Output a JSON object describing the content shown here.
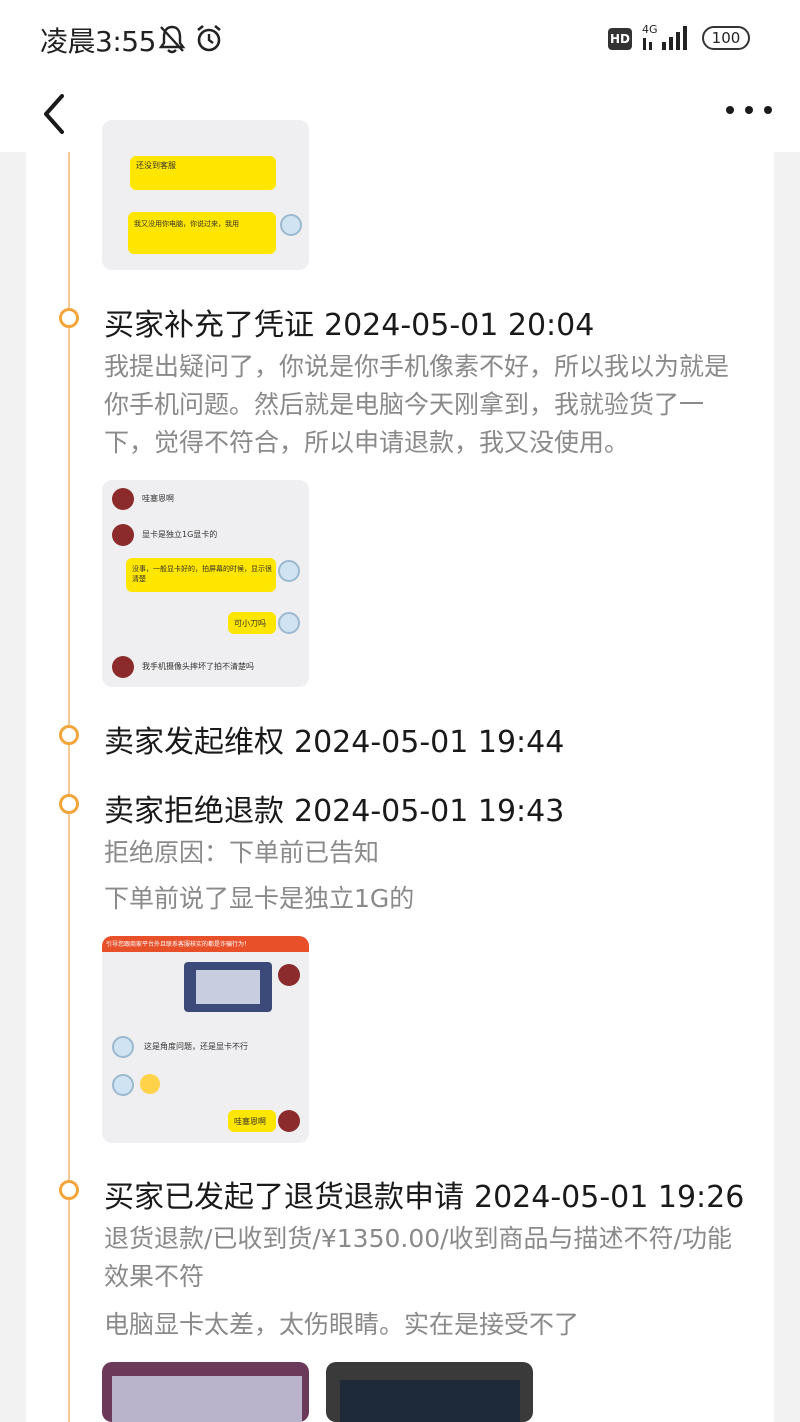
{
  "status_bar": {
    "time": "凌晨3:55",
    "network": "4G",
    "hd": "HD",
    "battery": "100"
  },
  "nav": {
    "back_icon": "back-arrow-icon",
    "more_icon": "more-dots-icon"
  },
  "colors": {
    "accent": "#f2a53a",
    "timeline": "#f3c895",
    "muted_text": "#8a8a8a",
    "chat_yellow": "#ffe600"
  },
  "events": [
    {
      "title": "买家补充了凭证",
      "time": "2024-05-01 20:04",
      "desc": "我提出疑问了，你说是你手机像素不好，所以我以为就是你手机问题。然后就是电脑今天刚拿到，我就验货了一下，觉得不符合，所以申请退款，我又没使用。"
    },
    {
      "title": "卖家发起维权",
      "time": "2024-05-01 19:44"
    },
    {
      "title": "卖家拒绝退款",
      "time": "2024-05-01 19:43",
      "reason": "拒绝原因：下单前已告知",
      "desc": "下单前说了显卡是独立1G的"
    },
    {
      "title": "买家已发起了退货退款申请",
      "time": "2024-05-01 19:26",
      "detail": "退货退款/已收到货/¥1350.00/收到商品与描述不符/功能效果不符",
      "desc": "电脑显卡太差，太伤眼睛。实在是接受不了"
    }
  ],
  "screenshots": {
    "top": {
      "msg1": "还没到客服",
      "msg2": "我又没用你电脑，你说过来，我用"
    },
    "mid": {
      "msg1": "哇塞恩啊",
      "msg2": "显卡是独立1G显卡的",
      "msg3": "没事，一般显卡好的，拍屏幕的时候，显示很清楚",
      "msg4": "可小刀吗",
      "msg5": "我手机摄像头摔坏了拍不清楚吗"
    },
    "bottom": {
      "banner": "引导您跟商家平台外且联系客服核实的都是诈骗行为！",
      "msg1": "这是角度问题，还是显卡不行",
      "msg2": "哇塞恩啊"
    }
  }
}
